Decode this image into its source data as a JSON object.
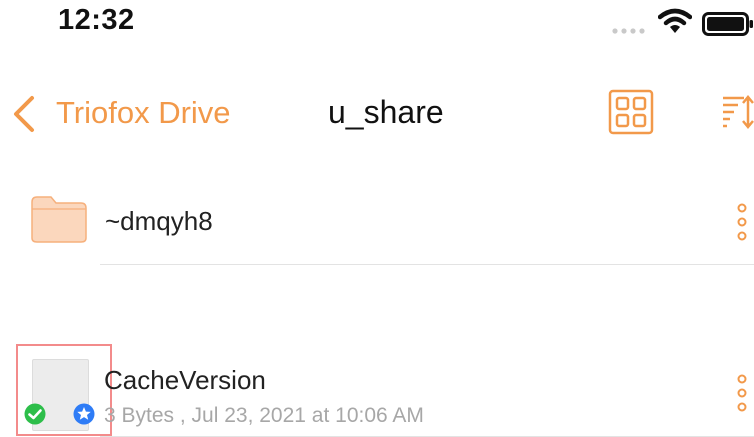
{
  "status_bar": {
    "time": "12:32",
    "icons": [
      "signal-icon",
      "wifi-icon",
      "battery-icon"
    ]
  },
  "nav_bar": {
    "back_label": "Triofox Drive",
    "title": "u_share",
    "actions": [
      "grid-view-icon",
      "sort-icon"
    ]
  },
  "colors": {
    "accent": "#F2994A",
    "folder": "#FBD7BD",
    "selection_border": "#F38B8B",
    "sync_ok": "#2DBE4A",
    "badge_blue": "#2E7CF6",
    "meta_text": "#A7A7A7"
  },
  "files": [
    {
      "name": "~dmqyh8",
      "type": "folder",
      "icon": "folder-icon",
      "more_icon": "more-vertical-icon"
    },
    {
      "name": "CacheVersion",
      "type": "file",
      "meta": "3 Bytes , Jul 23, 2021 at 10:06 AM",
      "icon": "file-icon",
      "badges": [
        "sync-check-icon",
        "star-badge-icon"
      ],
      "more_icon": "more-vertical-icon",
      "selected": true
    }
  ]
}
